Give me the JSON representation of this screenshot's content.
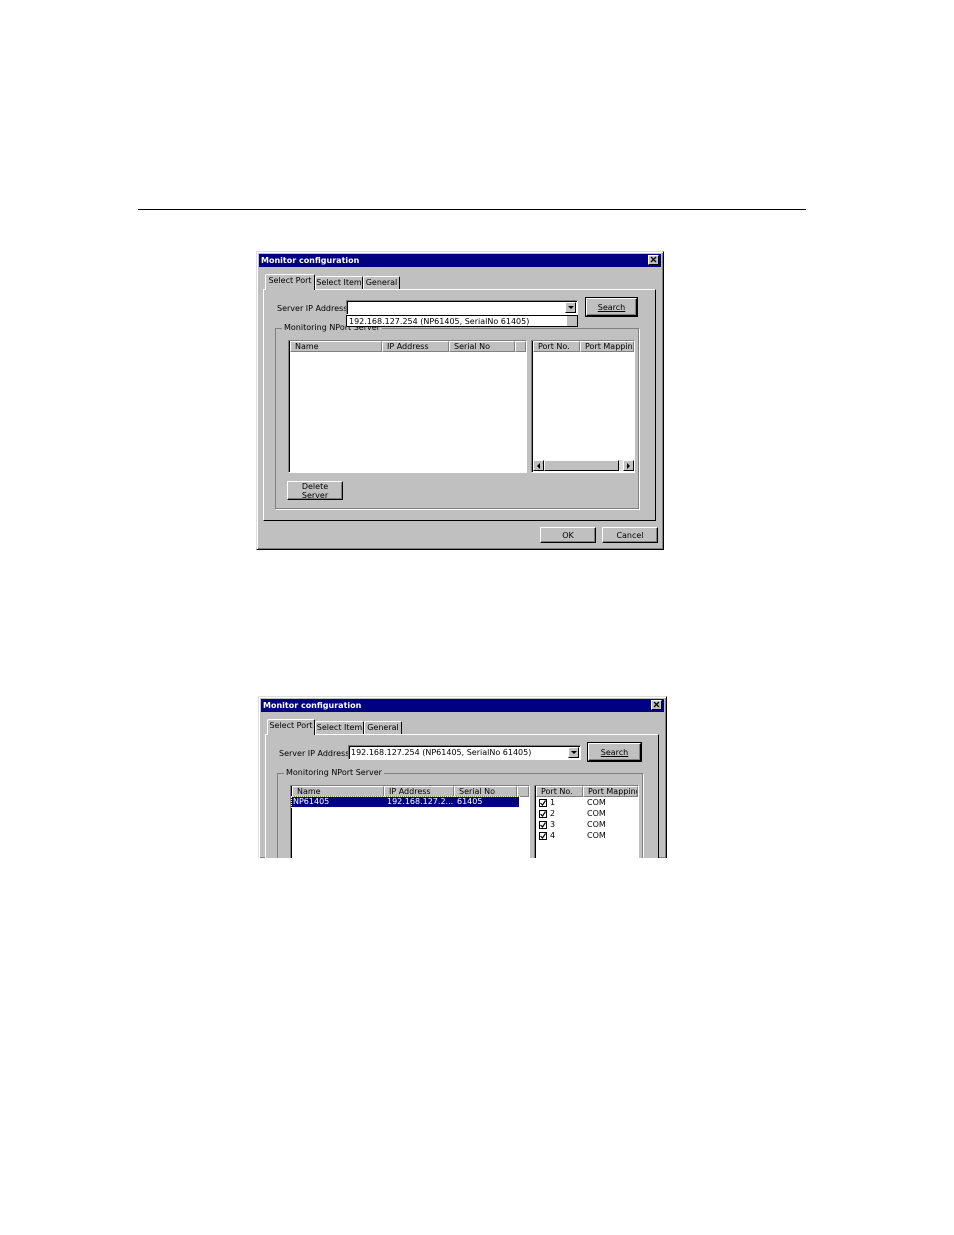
{
  "dialog1": {
    "title": "Monitor configuration",
    "tabs": [
      "Select Port",
      "Select Item",
      "General"
    ],
    "server_ip_label": "Server IP Address",
    "server_ip_value": "",
    "dropdown_item": "192.168.127.254 (NP61405, SerialNo 61405)",
    "search_button": "Search",
    "group_title": "Monitoring NPort Server",
    "server_columns": [
      "Name",
      "IP Address",
      "Serial No"
    ],
    "port_columns": [
      "Port No.",
      "Port Mapping"
    ],
    "delete_button": "Delete Server",
    "ok_button": "OK",
    "cancel_button": "Cancel"
  },
  "dialog2": {
    "title": "Monitor configuration",
    "tabs": [
      "Select Port",
      "Select Item",
      "General"
    ],
    "server_ip_label": "Server IP Address",
    "server_ip_value": "192.168.127.254 (NP61405, SerialNo 61405)",
    "search_button": "Search",
    "group_title": "Monitoring NPort Server",
    "server_columns": [
      "Name",
      "IP Address",
      "Serial No"
    ],
    "servers": [
      {
        "name": "NP61405",
        "ip": "192.168.127.2...",
        "serial": "61405"
      }
    ],
    "port_columns": [
      "Port No.",
      "Port Mapping"
    ],
    "ports": [
      {
        "port": "1",
        "mapping": "COM",
        "checked": true
      },
      {
        "port": "2",
        "mapping": "COM",
        "checked": true
      },
      {
        "port": "3",
        "mapping": "COM",
        "checked": true
      },
      {
        "port": "4",
        "mapping": "COM",
        "checked": true
      }
    ]
  },
  "colors": {
    "titlebar": "#000080",
    "face": "#c0c0c0",
    "selection": "#000080"
  }
}
